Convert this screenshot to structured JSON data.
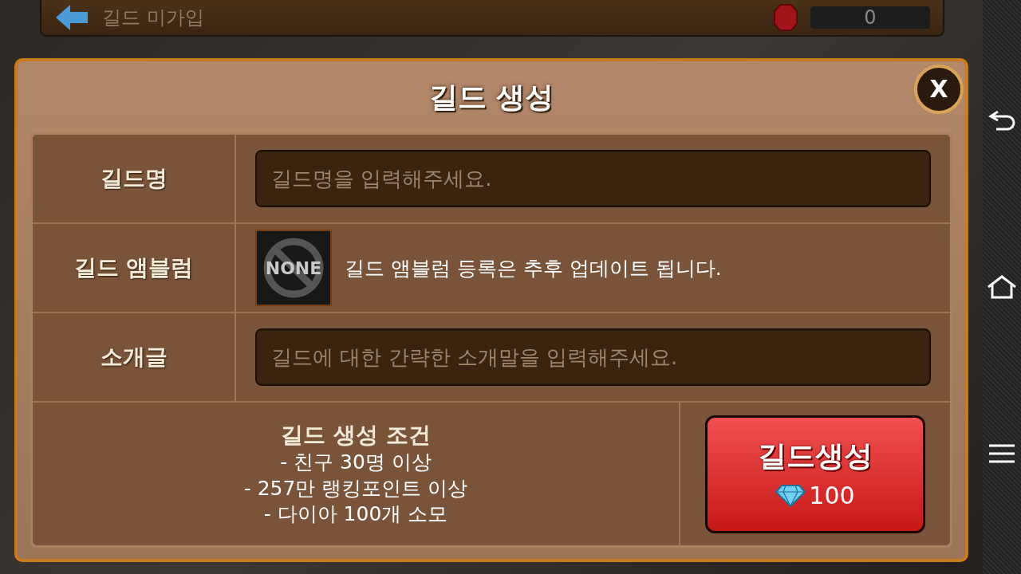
{
  "top_bar": {
    "title": "길드 미가입",
    "gem_count": "0"
  },
  "dialog": {
    "title": "길드 생성",
    "close_label": "X"
  },
  "form": {
    "rows": [
      {
        "kind": "input",
        "label": "길드명",
        "placeholder": "길드명을 입력해주세요."
      },
      {
        "kind": "emblem",
        "label": "길드 앰블럼",
        "emblem_text": "NONE",
        "note": "길드 앰블럼 등록은 추후 업데이트 됩니다."
      },
      {
        "kind": "input",
        "label": "소개글",
        "placeholder": "길드에 대한 간략한 소개말을 입력해주세요."
      }
    ]
  },
  "requirements": {
    "title": "길드 생성 조건",
    "lines": [
      "- 친구 30명 이상",
      "- 257만 랭킹포인트 이상",
      "- 다이아 100개 소모"
    ]
  },
  "create_button": {
    "label": "길드생성",
    "cost": "100"
  }
}
